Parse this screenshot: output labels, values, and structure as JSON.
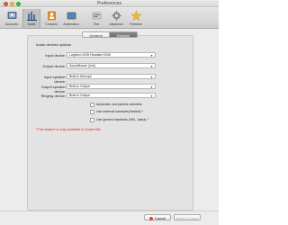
{
  "window": {
    "title": "Preferences"
  },
  "toolbar": {
    "items": [
      {
        "label": "Accounts",
        "icon": "accounts-icon"
      },
      {
        "label": "Audio",
        "icon": "audio-icon"
      },
      {
        "label": "Contacts",
        "icon": "contacts-icon"
      },
      {
        "label": "Automation",
        "icon": "automation-icon"
      },
      {
        "label": "Text",
        "icon": "text-icon"
      },
      {
        "label": "Advanced",
        "icon": "advanced-icon"
      },
      {
        "label": "Premium",
        "icon": "premium-icon"
      }
    ],
    "selected": "Audio"
  },
  "tabs": [
    {
      "label": "General",
      "selected": false
    },
    {
      "label": "Devices",
      "selected": true
    }
  ],
  "section": {
    "title": "Audio devices options"
  },
  "devices": [
    {
      "label": "Input device:",
      "value": "Logitech USB Headset H340"
    },
    {
      "label": "Output device:",
      "value": "Soundflower (2ch)"
    },
    {
      "label": "Input speaker device:",
      "value": "Built-in Microph"
    },
    {
      "label": "Output speaker device:",
      "value": "Built-in Output"
    },
    {
      "label": "Ringing device:",
      "value": "Built-in Output"
    }
  ],
  "checkboxes": [
    {
      "label": "Automatic microphone selection",
      "checked": false
    },
    {
      "label": "Use external handsets(Yealink) *",
      "checked": false
    },
    {
      "label": "Use generic handsets (HID, Jabra) *",
      "checked": false
    }
  ],
  "note": "*This feature is only available in Zoiper Biz",
  "footer": {
    "cancel_label": "Cancel",
    "apply_label": "Save & Close"
  },
  "colors": {
    "note": "#e02020",
    "accent_selected_tab": "#777777"
  }
}
